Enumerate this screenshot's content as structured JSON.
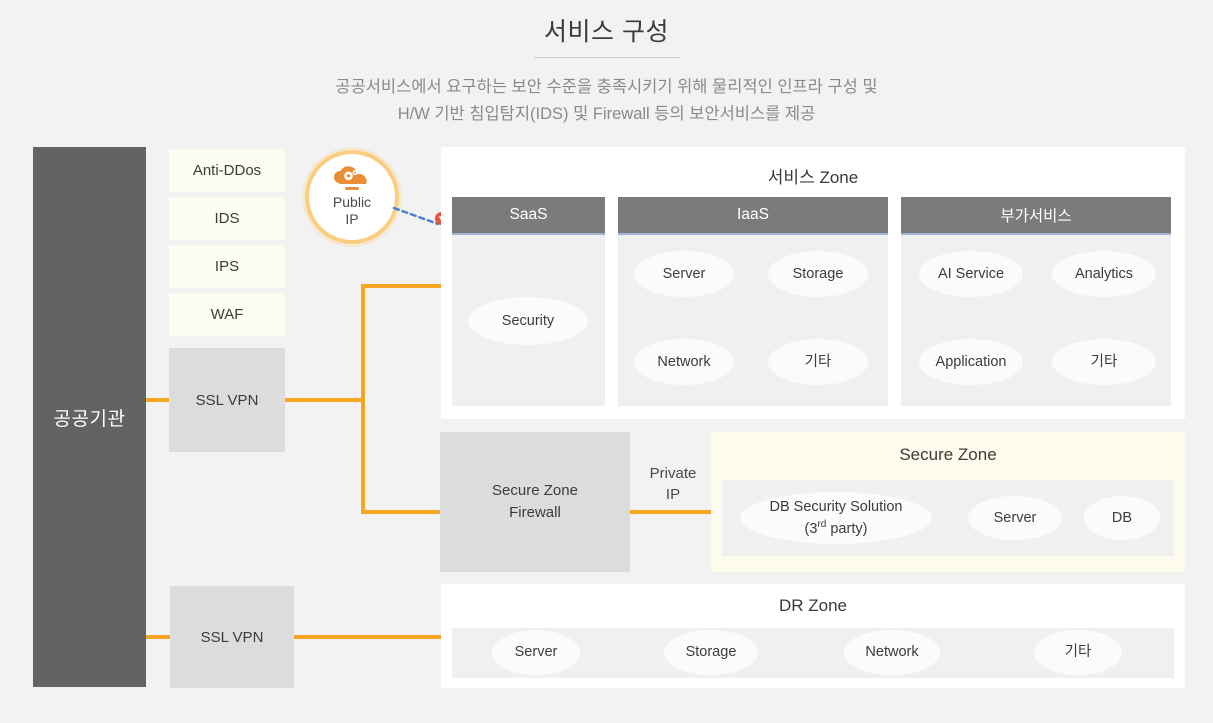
{
  "header": {
    "title": "서비스 구성",
    "subtitle_line1": "공공서비스에서 요구하는 보안 수준을 충족시키기 위해 물리적인 인프라 구성 및",
    "subtitle_line2": "H/W 기반 침입탐지(IDS) 및 Firewall 등의 보안서비스를 제공"
  },
  "org": {
    "label": "공공기관"
  },
  "security_stack": [
    {
      "label": "Anti-DDos"
    },
    {
      "label": "IDS"
    },
    {
      "label": "IPS"
    },
    {
      "label": "WAF"
    }
  ],
  "vpn": {
    "top_label": "SSL VPN",
    "bottom_label": "SSL VPN"
  },
  "public_ip": {
    "line1": "Public",
    "line2": "IP",
    "icon": "cloud-gear-icon"
  },
  "service_zone": {
    "title": "서비스 Zone",
    "columns": [
      {
        "head": "SaaS",
        "items": [
          {
            "label": "Security"
          }
        ]
      },
      {
        "head": "IaaS",
        "items": [
          {
            "label": "Server"
          },
          {
            "label": "Storage"
          },
          {
            "label": "Network"
          },
          {
            "label": "기타"
          }
        ]
      },
      {
        "head": "부가서비스",
        "items": [
          {
            "label": "AI Service"
          },
          {
            "label": "Analytics"
          },
          {
            "label": "Application"
          },
          {
            "label": "기타"
          }
        ]
      }
    ]
  },
  "firewall": {
    "line1": "Secure Zone",
    "line2": "Firewall"
  },
  "private_ip": {
    "line1": "Private",
    "line2": "IP"
  },
  "secure_zone": {
    "title": "Secure Zone",
    "items": [
      {
        "label_line1": "DB Security Solution",
        "label_line2_pre": "(3",
        "label_sup": "rd",
        "label_line2_post": " party)"
      },
      {
        "label": "Server"
      },
      {
        "label": "DB"
      }
    ]
  },
  "dr_zone": {
    "title": "DR Zone",
    "items": [
      {
        "label": "Server"
      },
      {
        "label": "Storage"
      },
      {
        "label": "Network"
      },
      {
        "label": "기타"
      }
    ]
  },
  "colors": {
    "accent_orange": "#f5a623",
    "cream": "#fdfcf0",
    "dark_gray": "#636363",
    "header_gray": "#7b7b7b",
    "panel_gray": "#f0f0f0",
    "box_gray": "#dcdcdc",
    "dashed_blue": "#4a7fd1",
    "marker_red": "#e8533f",
    "page_bg": "#f2f2f2"
  }
}
